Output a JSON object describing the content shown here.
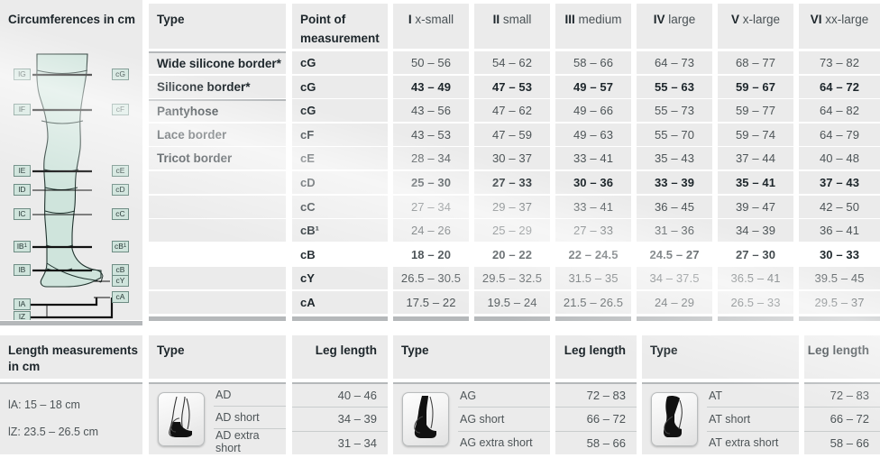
{
  "circ": {
    "title": "Circumferences in cm",
    "type_header": "Type",
    "point_header_line1": "Point of",
    "point_header_line2": "measurement",
    "types": [
      "Wide silicone border*",
      "Silicone border*",
      "Pantyhose",
      "Lace border",
      "Tricot border"
    ],
    "sizes": [
      {
        "roman": "I",
        "name": "x-small"
      },
      {
        "roman": "II",
        "name": "small"
      },
      {
        "roman": "III",
        "name": "medium"
      },
      {
        "roman": "IV",
        "name": "large"
      },
      {
        "roman": "V",
        "name": "x-large"
      },
      {
        "roman": "VI",
        "name": "xx-large"
      }
    ],
    "points": [
      "cG",
      "cG",
      "cG",
      "cF",
      "cE",
      "cD",
      "cC",
      "cB¹",
      "cB",
      "cY",
      "cA"
    ],
    "rows": [
      {
        "point": "cG",
        "bold": false,
        "white": false,
        "values": [
          "50 – 56",
          "54 – 62",
          "58 – 66",
          "64 – 73",
          "68 – 77",
          "73 – 82"
        ]
      },
      {
        "point": "cG",
        "bold": true,
        "white": false,
        "values": [
          "43 – 49",
          "47 – 53",
          "49 – 57",
          "55 – 63",
          "59 – 67",
          "64 – 72"
        ]
      },
      {
        "point": "cG",
        "bold": false,
        "white": false,
        "values": [
          "43 – 56",
          "47 – 62",
          "49 – 66",
          "55 – 73",
          "59 – 77",
          "64 – 82"
        ]
      },
      {
        "point": "cF",
        "bold": false,
        "white": false,
        "values": [
          "43 – 53",
          "47 – 59",
          "49 – 63",
          "55 – 70",
          "59 – 74",
          "64 – 79"
        ]
      },
      {
        "point": "cE",
        "bold": false,
        "white": false,
        "values": [
          "28 – 34",
          "30 – 37",
          "33 – 41",
          "35 – 43",
          "37 – 44",
          "40 – 48"
        ]
      },
      {
        "point": "cD",
        "bold": true,
        "white": false,
        "values": [
          "25 – 30",
          "27 – 33",
          "30 – 36",
          "33 – 39",
          "35 – 41",
          "37 – 43"
        ]
      },
      {
        "point": "cC",
        "bold": false,
        "white": false,
        "values": [
          "27 – 34",
          "29 – 37",
          "33 – 41",
          "36 – 45",
          "39 – 47",
          "42 – 50"
        ]
      },
      {
        "point": "cB¹",
        "bold": false,
        "white": false,
        "values": [
          "24 – 26",
          "25 – 29",
          "27 – 33",
          "31 – 36",
          "34 – 39",
          "36 – 41"
        ]
      },
      {
        "point": "cB",
        "bold": true,
        "white": true,
        "values": [
          "18 – 20",
          "20 – 22",
          "22 – 24.5",
          "24.5 – 27",
          "27 – 30",
          "30 – 33"
        ]
      },
      {
        "point": "cY",
        "bold": false,
        "white": false,
        "values": [
          "26.5 – 30.5",
          "29.5 – 32.5",
          "31.5 – 35",
          "34 – 37.5",
          "36.5 – 41",
          "39.5 – 45"
        ]
      },
      {
        "point": "cA",
        "bold": false,
        "white": false,
        "values": [
          "17.5 – 22",
          "19.5 – 24",
          "21.5 – 26.5",
          "24 – 29",
          "26.5 – 33",
          "29.5 – 37"
        ]
      }
    ]
  },
  "diagram": {
    "left_labels": [
      "lG",
      "lF",
      "lE",
      "lD",
      "lC",
      "lB¹",
      "lB",
      "lA",
      "lZ"
    ],
    "right_labels": [
      "cG",
      "cF",
      "cE",
      "cD",
      "cC",
      "cB¹",
      "cB",
      "cY",
      "cA"
    ]
  },
  "lengths": {
    "title_line1": "Length measurements",
    "title_line2": "in cm",
    "notes": [
      "lA: 15 – 18 cm",
      "lZ: 23.5 – 26.5 cm"
    ],
    "type_header": "Type",
    "leg_length_header": "Leg length",
    "groups": [
      {
        "icon": "stocking-ad-icon",
        "rows": [
          {
            "type": "AD",
            "length": "40 – 46"
          },
          {
            "type": "AD short",
            "length": "34 – 39"
          },
          {
            "type": "AD extra short",
            "length": "31 – 34"
          }
        ]
      },
      {
        "icon": "stocking-ag-icon",
        "rows": [
          {
            "type": "AG",
            "length": "72 – 83"
          },
          {
            "type": "AG short",
            "length": "66 – 72"
          },
          {
            "type": "AG extra short",
            "length": "58 – 66"
          }
        ]
      },
      {
        "icon": "stocking-at-icon",
        "rows": [
          {
            "type": "AT",
            "length": "72 – 83"
          },
          {
            "type": "AT short",
            "length": "66 – 72"
          },
          {
            "type": "AT extra short",
            "length": "58 – 66"
          }
        ]
      }
    ]
  },
  "colors": {
    "cell_bg": "#ebebeb",
    "separator": "#b5b8ba",
    "text": "#3c4347",
    "heading": "#1d262b",
    "diagram_leg": "#cfe4dc",
    "diagram_tag_border": "#6e8c84"
  }
}
